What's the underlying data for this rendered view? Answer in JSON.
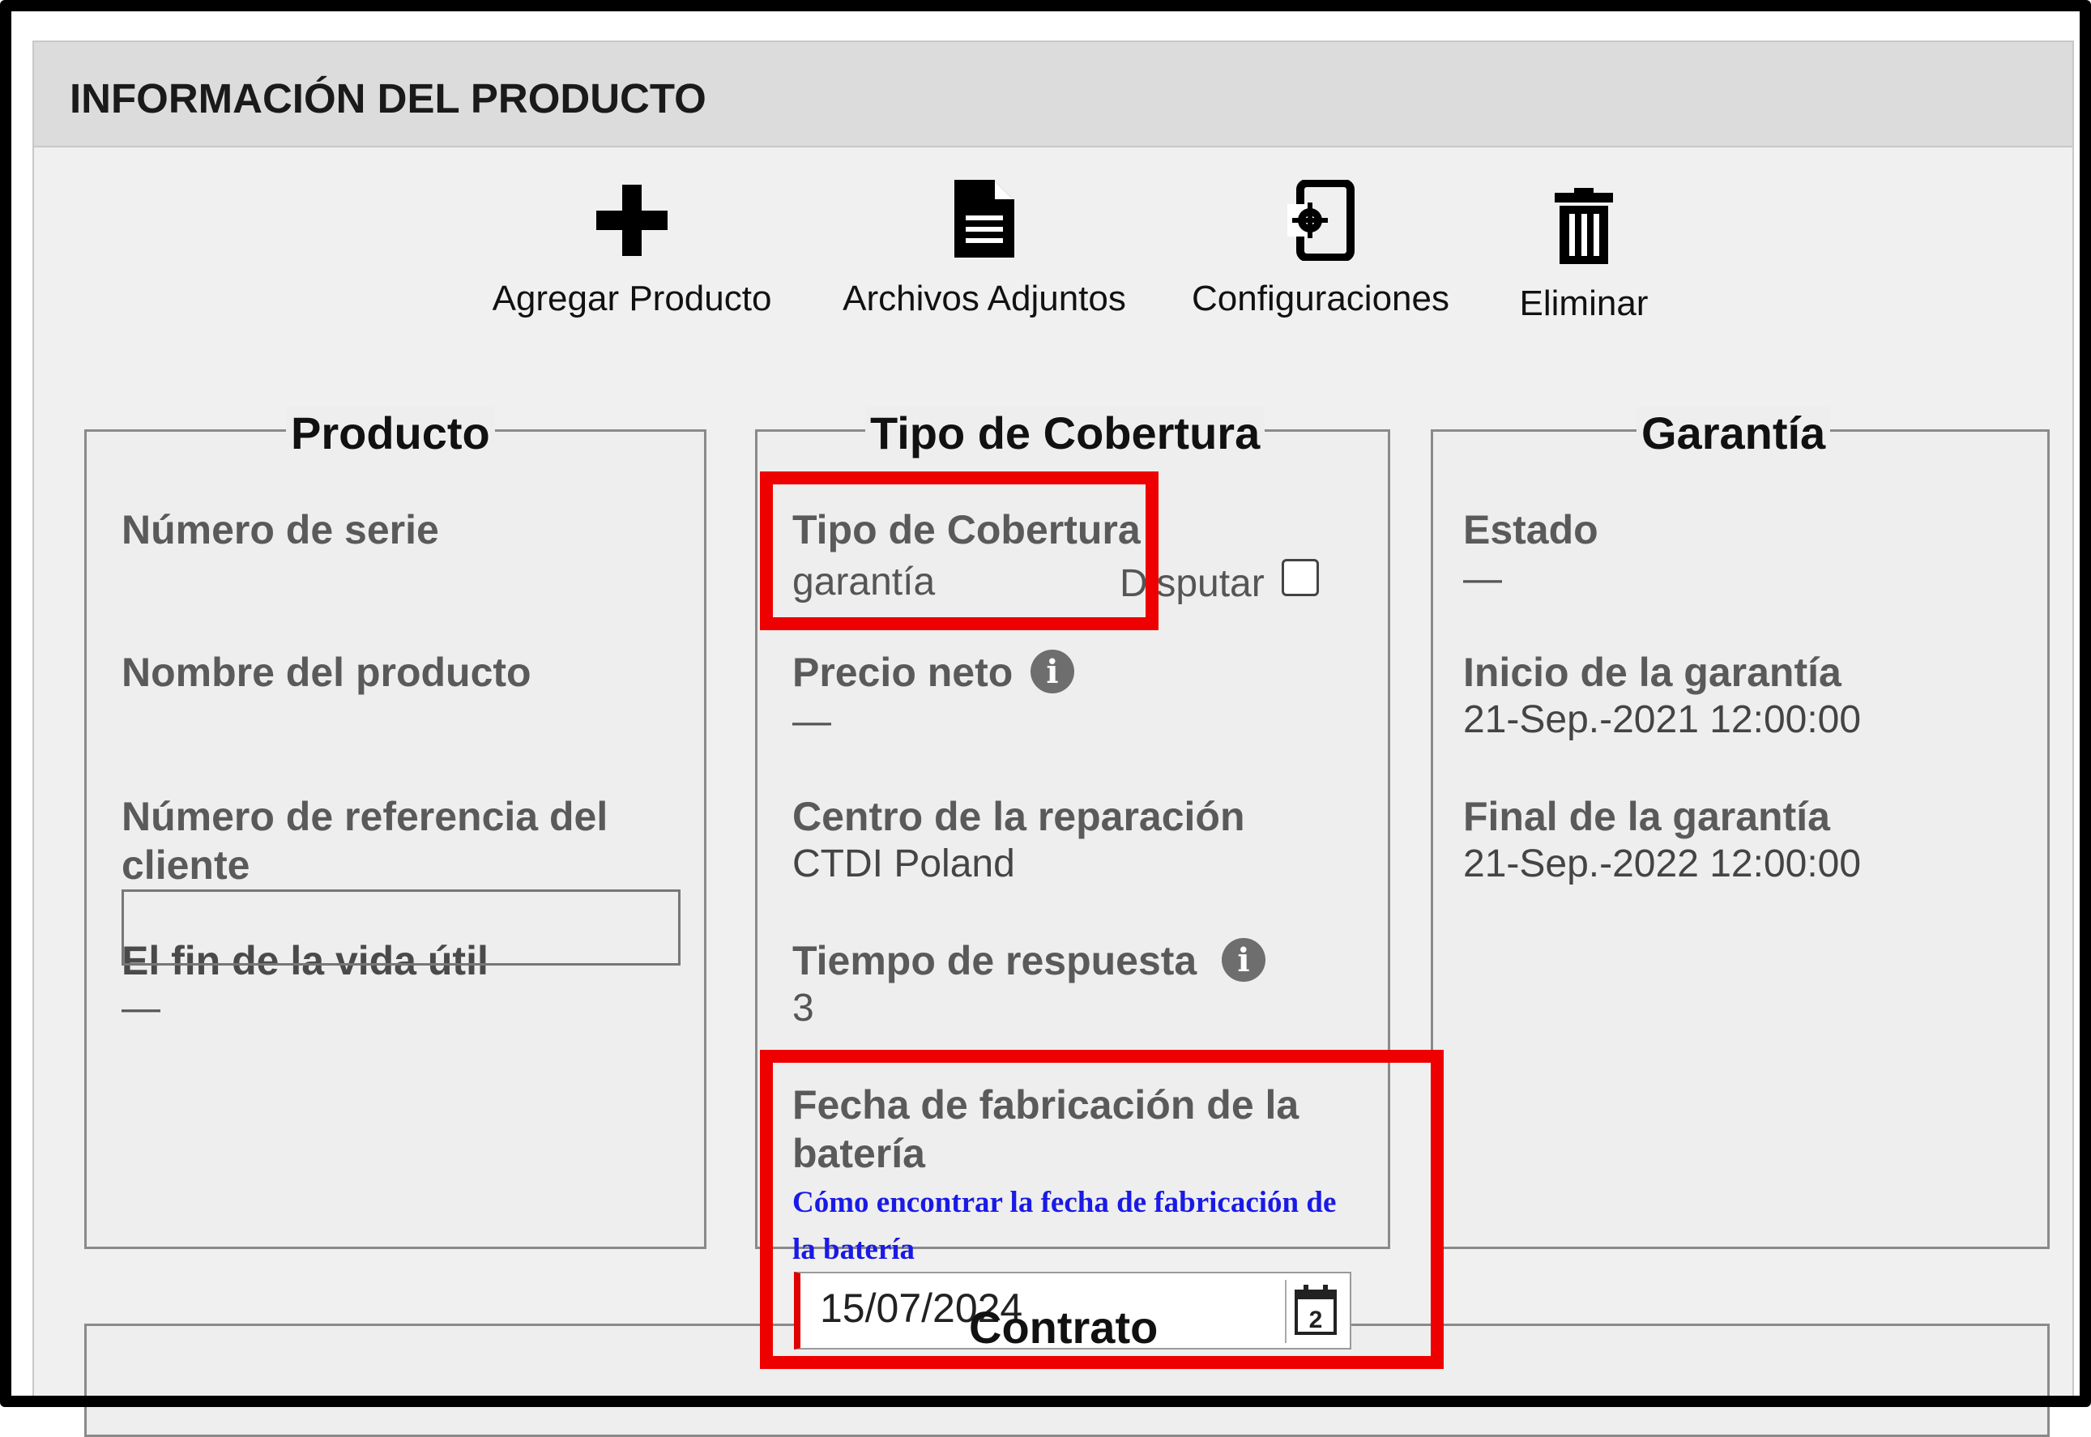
{
  "panel": {
    "title": "INFORMACIÓN DEL PRODUCTO"
  },
  "toolbar": {
    "add_label": "Agregar Producto",
    "attachments_label": "Archivos Adjuntos",
    "settings_label": "Configuraciones",
    "delete_label": "Eliminar"
  },
  "product": {
    "title": "Producto",
    "serial_label": "Número de serie",
    "name_label": "Nombre del producto",
    "customer_ref_label_line1": "Número de referencia del",
    "customer_ref_label_line2": "cliente",
    "customer_ref_value": "",
    "end_of_life_label": "El fin de la vida útil",
    "end_of_life_value": "—"
  },
  "coverage": {
    "title": "Tipo de Cobertura",
    "type_label": "Tipo de Cobertura",
    "type_value": "garantía",
    "dispute_label": "Disputar",
    "dispute_checked": false,
    "net_price_label": "Precio neto",
    "net_price_value": "—",
    "repair_center_label": "Centro de la reparación",
    "repair_center_value": "CTDI Poland",
    "response_time_label": "Tiempo de respuesta",
    "response_time_value": "3",
    "battery_date_label_line1": "Fecha de fabricación de la",
    "battery_date_label_line2": "batería",
    "battery_link_line1": "Cómo encontrar la fecha de fabricación de",
    "battery_link_line2": "la batería",
    "battery_date_value": "15/07/2024",
    "calendar_day": "2"
  },
  "warranty": {
    "title": "Garantía",
    "status_label": "Estado",
    "status_value": "—",
    "start_label": "Inicio de la garantía",
    "start_value": "21-Sep.-2021 12:00:00",
    "end_label": "Final de la garantía",
    "end_value": "21-Sep.-2022 12:00:00"
  },
  "contract": {
    "title": "Contrato"
  },
  "colors": {
    "highlight": "#ee0000",
    "link": "#1a1ae6"
  }
}
